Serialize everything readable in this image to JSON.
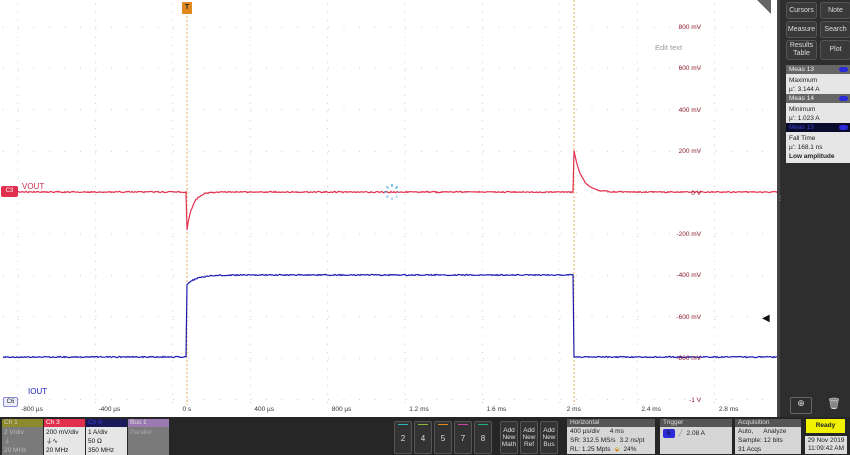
{
  "plot": {
    "y_labels": [
      "800 mV",
      "600 mV",
      "400 mV",
      "200 mV",
      "0 V",
      "-200 mV",
      "-400 mV",
      "-600 mV",
      "-800 mV",
      "-1 V"
    ],
    "x_labels": [
      "-800 µs",
      "-400 µs",
      "0 s",
      "400 µs",
      "800 µs",
      "1.2 ms",
      "1.6 ms",
      "2 ms",
      "2.4 ms",
      "2.8 ms"
    ],
    "edit_text": "Edit text",
    "trigger_marker": "T",
    "ch3_badge": "C3",
    "ch3_label": "VOUT",
    "ch3_color": "#e0304e",
    "ch6_badge": "C6",
    "ch6_label": "IOUT",
    "ch6_color": "#1a1ab0",
    "vout": {
      "baseline_mV": 0,
      "dip_mV": -180,
      "dip_time_ms": 0,
      "spike_mV": 200,
      "spike_time_ms": 2
    },
    "iout": {
      "low_A": 1.023,
      "high_A": 3.144,
      "step_up_ms": 0,
      "step_down_ms": 2
    }
  },
  "right": {
    "buttons": [
      "Cursors",
      "Note",
      "Measure",
      "Search",
      "Results Table",
      "Plot"
    ],
    "meas": [
      {
        "title": "Meas 13",
        "name": "Maximum",
        "value": "µ': 3.144 A",
        "extra": ""
      },
      {
        "title": "Meas 14",
        "name": "Minimum",
        "value": "µ': 1.023 A",
        "extra": ""
      },
      {
        "title": "Meas 15",
        "name": "Fall Time",
        "value": "µ': 168.1 ns",
        "extra": "Low amplitude"
      }
    ]
  },
  "bottom": {
    "ch1": {
      "title": "Ch 1",
      "scale": "2 V/div",
      "bw": "20 MHz"
    },
    "ch3": {
      "title": "Ch 3",
      "scale": "200 mV/div",
      "bw": "20 MHz"
    },
    "ch6": {
      "title": "Ch 6",
      "scale": "1 A/div",
      "imp": "50 Ω",
      "bw": "350 MHz"
    },
    "bus1": {
      "title": "Bus 1",
      "type": "Parallel"
    },
    "channels": [
      "2",
      "4",
      "5",
      "7",
      "8"
    ],
    "add": [
      "Add New Math",
      "Add New Ref",
      "Add New Bus"
    ],
    "horizontal": {
      "title": "Horizontal",
      "scale": "400 µs/div",
      "pos": "4 ms",
      "sr": "SR: 312.5 MS/s",
      "pt": "3.2 ns/pt",
      "rl": "RL: 1.25 Mpts",
      "pct": "24%"
    },
    "trigger": {
      "title": "Trigger",
      "src": "6",
      "level": "2.08 A"
    },
    "acq": {
      "title": "Acquisition",
      "mode": "Auto,",
      "analyze": "Analyze",
      "sample": "Sample: 12 bits",
      "acqs": "31 Acqs"
    },
    "ready": "Ready",
    "date": "29 Nov 2019",
    "time": "11:09:42 AM"
  }
}
